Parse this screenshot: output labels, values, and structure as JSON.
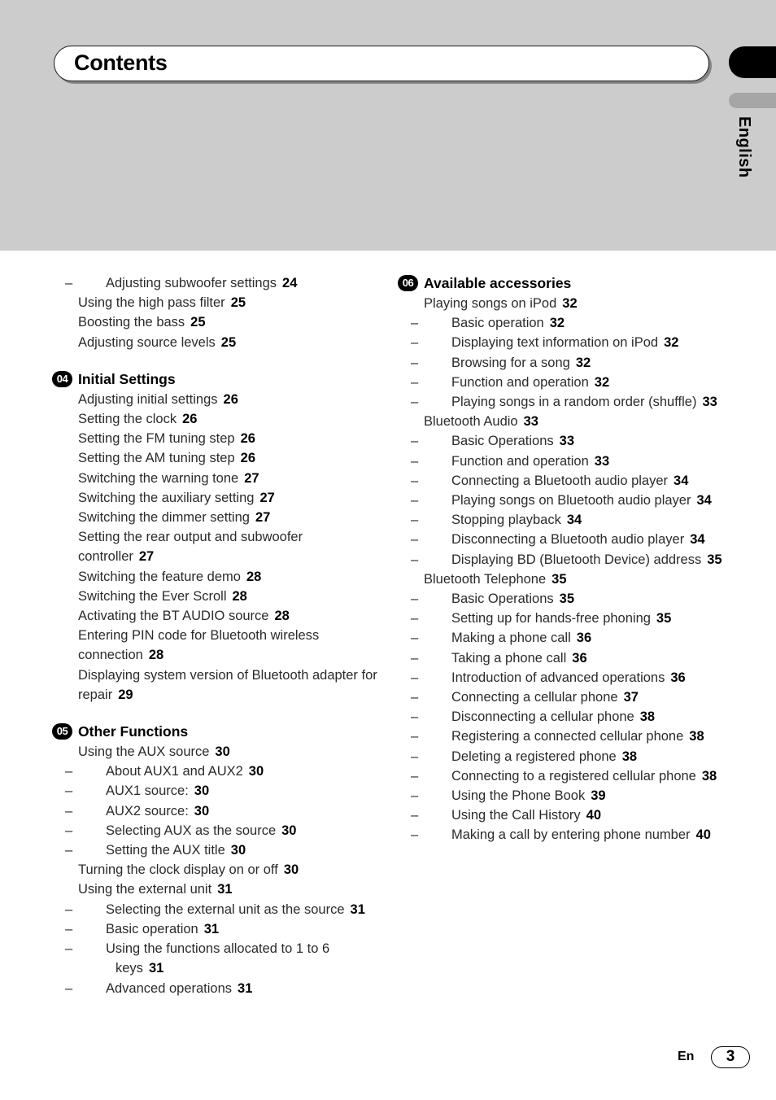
{
  "header": {
    "title": "Contents"
  },
  "sidebar": {
    "language_label": "English"
  },
  "footer": {
    "language_code": "En",
    "page_number": "3"
  },
  "columns": {
    "left": [
      {
        "type": "entry",
        "level": 2,
        "dash": "–",
        "text": "Adjusting subwoofer settings",
        "page": "24"
      },
      {
        "type": "entry",
        "level": 1,
        "text": "Using the high pass filter",
        "page": "25"
      },
      {
        "type": "entry",
        "level": 1,
        "text": "Boosting the bass",
        "page": "25"
      },
      {
        "type": "entry",
        "level": 1,
        "text": "Adjusting source levels",
        "page": "25"
      },
      {
        "type": "chapter",
        "badge": "04",
        "title": "Initial Settings"
      },
      {
        "type": "entry",
        "level": 1,
        "text": "Adjusting initial settings",
        "page": "26"
      },
      {
        "type": "entry",
        "level": 1,
        "text": "Setting the clock",
        "page": "26"
      },
      {
        "type": "entry",
        "level": 1,
        "text": "Setting the FM tuning step",
        "page": "26"
      },
      {
        "type": "entry",
        "level": 1,
        "text": "Setting the AM tuning step",
        "page": "26"
      },
      {
        "type": "entry",
        "level": 1,
        "text": "Switching the warning tone",
        "page": "27"
      },
      {
        "type": "entry",
        "level": 1,
        "text": "Switching the auxiliary setting",
        "page": "27"
      },
      {
        "type": "entry",
        "level": 1,
        "text": "Switching the dimmer setting",
        "page": "27"
      },
      {
        "type": "entry",
        "level": 1,
        "text": "Setting the rear output and subwoofer controller",
        "page": "27"
      },
      {
        "type": "entry",
        "level": 1,
        "text": "Switching the feature demo",
        "page": "28"
      },
      {
        "type": "entry",
        "level": 1,
        "text": "Switching the Ever Scroll",
        "page": "28"
      },
      {
        "type": "entry",
        "level": 1,
        "text": "Activating the BT AUDIO source",
        "page": "28"
      },
      {
        "type": "entry",
        "level": 1,
        "text": "Entering PIN code for Bluetooth wireless connection",
        "page": "28"
      },
      {
        "type": "entry",
        "level": 1,
        "text": "Displaying system version of Bluetooth adapter for repair",
        "page": "29"
      },
      {
        "type": "chapter",
        "badge": "05",
        "title": "Other Functions"
      },
      {
        "type": "entry",
        "level": 1,
        "text": "Using the AUX source",
        "page": "30"
      },
      {
        "type": "entry",
        "level": 2,
        "dash": "–",
        "text": "About AUX1 and AUX2",
        "page": "30"
      },
      {
        "type": "entry",
        "level": 2,
        "dash": "–",
        "text": "AUX1 source:",
        "page": "30"
      },
      {
        "type": "entry",
        "level": 2,
        "dash": "–",
        "text": "AUX2 source:",
        "page": "30"
      },
      {
        "type": "entry",
        "level": 2,
        "dash": "–",
        "text": "Selecting AUX as the source",
        "page": "30"
      },
      {
        "type": "entry",
        "level": 2,
        "dash": "–",
        "text": "Setting the AUX title",
        "page": "30"
      },
      {
        "type": "entry",
        "level": 1,
        "text": "Turning the clock display on or off",
        "page": "30"
      },
      {
        "type": "entry",
        "level": 1,
        "text": "Using the external unit",
        "page": "31"
      },
      {
        "type": "entry",
        "level": 2,
        "dash": "–",
        "text": "Selecting the external unit as the source",
        "page": "31"
      },
      {
        "type": "entry",
        "level": 2,
        "dash": "–",
        "text": "Basic operation",
        "page": "31"
      },
      {
        "type": "entry",
        "level": 2,
        "dash": "–",
        "text": "Using the functions allocated to 1 to 6 keys",
        "page": "31"
      },
      {
        "type": "entry",
        "level": 2,
        "dash": "–",
        "text": "Advanced operations",
        "page": "31"
      }
    ],
    "right": [
      {
        "type": "chapter",
        "badge": "06",
        "title": "Available accessories",
        "first": true
      },
      {
        "type": "entry",
        "level": 1,
        "text": "Playing songs on iPod",
        "page": "32"
      },
      {
        "type": "entry",
        "level": 2,
        "dash": "–",
        "text": "Basic operation",
        "page": "32"
      },
      {
        "type": "entry",
        "level": 2,
        "dash": "–",
        "text": "Displaying text information on iPod",
        "page": "32"
      },
      {
        "type": "entry",
        "level": 2,
        "dash": "–",
        "text": "Browsing for a song",
        "page": "32"
      },
      {
        "type": "entry",
        "level": 2,
        "dash": "–",
        "text": "Function and operation",
        "page": "32"
      },
      {
        "type": "entry",
        "level": 2,
        "dash": "–",
        "text": "Playing songs in a random order (shuffle)",
        "page": "33"
      },
      {
        "type": "entry",
        "level": 1,
        "text": "Bluetooth Audio",
        "page": "33"
      },
      {
        "type": "entry",
        "level": 2,
        "dash": "–",
        "text": "Basic Operations",
        "page": "33"
      },
      {
        "type": "entry",
        "level": 2,
        "dash": "–",
        "text": "Function and operation",
        "page": "33"
      },
      {
        "type": "entry",
        "level": 2,
        "dash": "–",
        "text": "Connecting a Bluetooth audio player",
        "page": "34"
      },
      {
        "type": "entry",
        "level": 2,
        "dash": "–",
        "text": "Playing songs on Bluetooth audio player",
        "page": "34"
      },
      {
        "type": "entry",
        "level": 2,
        "dash": "–",
        "text": "Stopping playback",
        "page": "34"
      },
      {
        "type": "entry",
        "level": 2,
        "dash": "–",
        "text": "Disconnecting a Bluetooth audio player",
        "page": "34"
      },
      {
        "type": "entry",
        "level": 2,
        "dash": "–",
        "text": "Displaying BD (Bluetooth Device) address",
        "page": "35"
      },
      {
        "type": "entry",
        "level": 1,
        "text": "Bluetooth Telephone",
        "page": "35"
      },
      {
        "type": "entry",
        "level": 2,
        "dash": "–",
        "text": "Basic Operations",
        "page": "35"
      },
      {
        "type": "entry",
        "level": 2,
        "dash": "–",
        "text": "Setting up for hands-free phoning",
        "page": "35"
      },
      {
        "type": "entry",
        "level": 2,
        "dash": "–",
        "text": "Making a phone call",
        "page": "36"
      },
      {
        "type": "entry",
        "level": 2,
        "dash": "–",
        "text": "Taking a phone call",
        "page": "36"
      },
      {
        "type": "entry",
        "level": 2,
        "dash": "–",
        "text": "Introduction of advanced operations",
        "page": "36"
      },
      {
        "type": "entry",
        "level": 2,
        "dash": "–",
        "text": "Connecting a cellular phone",
        "page": "37"
      },
      {
        "type": "entry",
        "level": 2,
        "dash": "–",
        "text": "Disconnecting a cellular phone",
        "page": "38"
      },
      {
        "type": "entry",
        "level": 2,
        "dash": "–",
        "text": "Registering a connected cellular phone",
        "page": "38"
      },
      {
        "type": "entry",
        "level": 2,
        "dash": "–",
        "text": "Deleting a registered phone",
        "page": "38"
      },
      {
        "type": "entry",
        "level": 2,
        "dash": "–",
        "text": "Connecting to a registered cellular phone",
        "page": "38"
      },
      {
        "type": "entry",
        "level": 2,
        "dash": "–",
        "text": "Using the Phone Book",
        "page": "39"
      },
      {
        "type": "entry",
        "level": 2,
        "dash": "–",
        "text": "Using the Call History",
        "page": "40"
      },
      {
        "type": "entry",
        "level": 2,
        "dash": "–",
        "text": "Making a call by entering phone number",
        "page": "40"
      }
    ]
  }
}
